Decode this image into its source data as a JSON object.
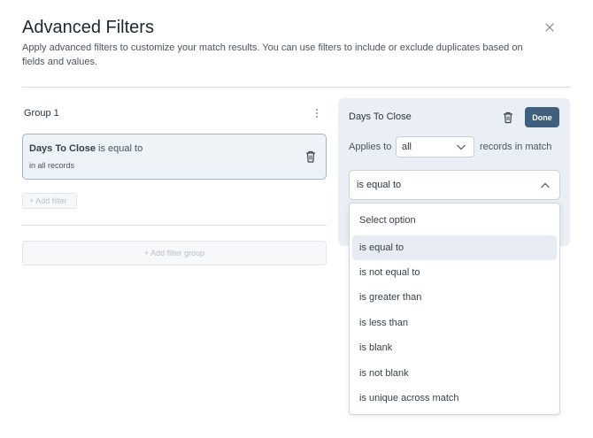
{
  "header": {
    "title": "Advanced Filters",
    "subtitle": "Apply advanced filters to customize your match results. You can use filters to include or exclude duplicates based on fields and values."
  },
  "group": {
    "label": "Group 1",
    "filter": {
      "field": "Days To Close",
      "operator_text": " is equal to",
      "scope": "in all records"
    },
    "add_filter_label": "+ Add filter",
    "add_group_label": "+ Add filter group"
  },
  "editor": {
    "field_title": "Days To Close",
    "done_label": "Done",
    "applies_to_label": "Applies to",
    "applies_to_value": "all",
    "records_label": "records in match",
    "operator_value": "is equal to",
    "options": [
      {
        "label": "Select option",
        "selected": false
      },
      {
        "label": "is equal to",
        "selected": true
      },
      {
        "label": "is not equal to",
        "selected": false
      },
      {
        "label": "is greater than",
        "selected": false
      },
      {
        "label": "is less than",
        "selected": false
      },
      {
        "label": "is blank",
        "selected": false
      },
      {
        "label": "is not blank",
        "selected": false
      },
      {
        "label": "is unique across match",
        "selected": false
      }
    ]
  },
  "colors": {
    "primary_button": "#3f5f7e",
    "panel_background": "#e9eff5",
    "selected_card_border": "#9db4cc"
  },
  "icons": [
    "close-icon",
    "kebab-icon",
    "trash-icon",
    "chevron-down-icon",
    "chevron-up-icon"
  ]
}
